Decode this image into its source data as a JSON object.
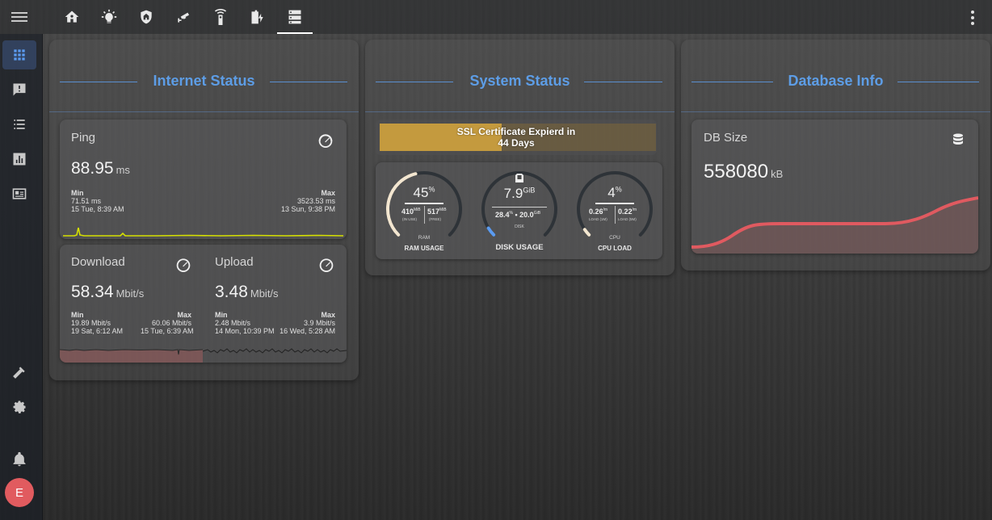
{
  "topbar": {
    "tabs": [
      {
        "icon": "home-icon",
        "active": false
      },
      {
        "icon": "lightbulb-icon",
        "active": false
      },
      {
        "icon": "shield-home-icon",
        "active": false
      },
      {
        "icon": "cctv-icon",
        "active": false
      },
      {
        "icon": "remote-icon",
        "active": false
      },
      {
        "icon": "battery-charging-icon",
        "active": false
      },
      {
        "icon": "server-icon",
        "active": true
      }
    ],
    "menu_icon": "menu-icon",
    "overflow_icon": "dots-vertical-icon"
  },
  "sidebar": {
    "items": [
      {
        "icon": "view-dashboard-icon",
        "active": true
      },
      {
        "icon": "message-alert-icon",
        "active": false
      },
      {
        "icon": "format-list-bulleted-icon",
        "active": false
      },
      {
        "icon": "chart-box-icon",
        "active": false
      },
      {
        "icon": "card-account-details-icon",
        "active": false
      }
    ],
    "bottom": [
      {
        "icon": "hammer-icon"
      },
      {
        "icon": "cog-icon"
      },
      {
        "icon": "bell-icon"
      }
    ],
    "avatar_letter": "E",
    "avatar_color": "#e15b5f"
  },
  "internet": {
    "title": "Internet Status",
    "ping": {
      "name": "Ping",
      "value": "88.95",
      "unit": "ms",
      "min_label": "Min",
      "min_value": "71.51 ms",
      "min_time": "15 Tue, 8:39 AM",
      "max_label": "Max",
      "max_value": "3523.53 ms",
      "max_time": "13 Sun, 9:38 PM"
    },
    "download": {
      "name": "Download",
      "value": "58.34",
      "unit": "Mbit/s",
      "min_label": "Min",
      "min_value": "19.89 Mbit/s",
      "min_time": "19 Sat, 6:12 AM",
      "max_label": "Max",
      "max_value": "60.06 Mbit/s",
      "max_time": "15 Tue, 6:39 AM"
    },
    "upload": {
      "name": "Upload",
      "value": "3.48",
      "unit": "Mbit/s",
      "min_label": "Min",
      "min_value": "2.48 Mbit/s",
      "min_time": "14 Mon, 10:39 PM",
      "max_label": "Max",
      "max_value": "3.9 Mbit/s",
      "max_time": "16 Wed, 5:28 AM"
    }
  },
  "system": {
    "title": "System Status",
    "ssl_line1": "SSL Certificate Expierd in",
    "ssl_line2": "44 Days",
    "ram": {
      "percent": "45",
      "percent_unit": "%",
      "used": "410",
      "used_unit": "MiB",
      "used_caption": "(IN USE)",
      "free": "517",
      "free_unit": "MiB",
      "free_caption": "(FREE)",
      "label": "RAM",
      "name": "RAM USAGE",
      "fill_fraction": 0.45
    },
    "disk": {
      "value": "7.9",
      "unit": "GiB",
      "used_pct": "28.4",
      "used_pct_unit": "%",
      "sep": "•",
      "total": "20.0",
      "total_unit": "GiB",
      "label": "DISK",
      "name": "DISK USAGE",
      "fill_fraction": 0.05
    },
    "cpu": {
      "percent": "4",
      "percent_unit": "%",
      "load1": "0.26",
      "load1_unit": "/m",
      "load1_caption": "LOAD (1M)",
      "load5": "0.22",
      "load5_unit": "/m",
      "load5_caption": "LOAD (5M)",
      "label": "CPU",
      "name": "CPU LOAD",
      "fill_fraction": 0.04
    }
  },
  "database": {
    "title": "Database Info",
    "name": "DB Size",
    "value": "558080",
    "unit": "kB"
  },
  "colors": {
    "accent": "#5d9de6",
    "ping_line": "#d6e000",
    "download_fill": "#8a5a5a",
    "db_line": "#e05a60",
    "ssl_fill": "#c49a3e"
  }
}
